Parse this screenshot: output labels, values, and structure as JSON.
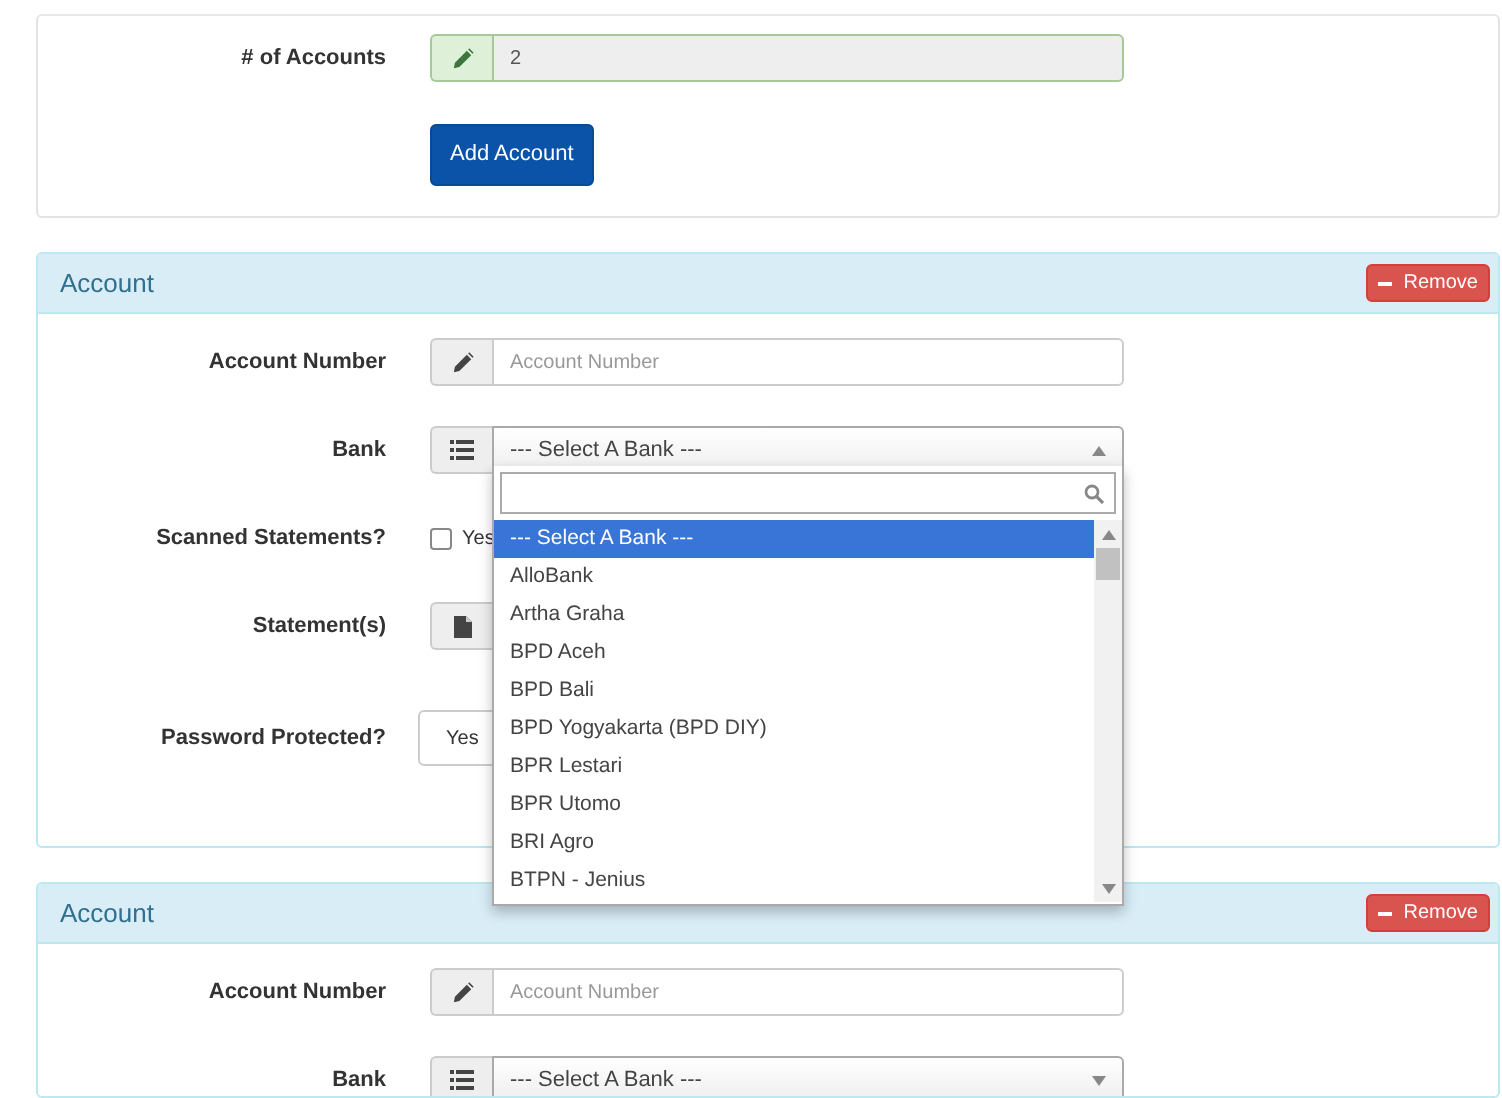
{
  "summary": {
    "label": "# of Accounts",
    "value": "2",
    "button": "Add Account"
  },
  "accounts": [
    {
      "title": "Account",
      "remove": "Remove",
      "fields": [
        {
          "kind": "text",
          "label": "Account Number",
          "placeholder": "Account Number"
        },
        {
          "kind": "select",
          "label": "Bank",
          "value": "--- Select A Bank ---",
          "expanded": true,
          "options": [
            {
              "label": "--- Select A Bank ---",
              "selected": true
            },
            {
              "label": "AlloBank",
              "selected": false
            },
            {
              "label": "Artha Graha",
              "selected": false
            },
            {
              "label": "BPD Aceh",
              "selected": false
            },
            {
              "label": "BPD Bali",
              "selected": false
            },
            {
              "label": "BPD Yogyakarta (BPD DIY)",
              "selected": false
            },
            {
              "label": "BPR Lestari",
              "selected": false
            },
            {
              "label": "BPR Utomo",
              "selected": false
            },
            {
              "label": "BRI Agro",
              "selected": false
            },
            {
              "label": "BTPN - Jenius",
              "selected": false
            }
          ]
        },
        {
          "kind": "checkbox",
          "label": "Scanned Statements?",
          "option": "Yes",
          "checked": false
        },
        {
          "kind": "file",
          "label": "Statement(s)"
        },
        {
          "kind": "toggle",
          "label": "Password Protected?",
          "option": "Yes"
        }
      ]
    },
    {
      "title": "Account",
      "remove": "Remove",
      "fields": [
        {
          "kind": "text",
          "label": "Account Number",
          "placeholder": "Account Number"
        },
        {
          "kind": "select",
          "label": "Bank",
          "value": "--- Select A Bank ---",
          "expanded": false
        }
      ]
    }
  ]
}
